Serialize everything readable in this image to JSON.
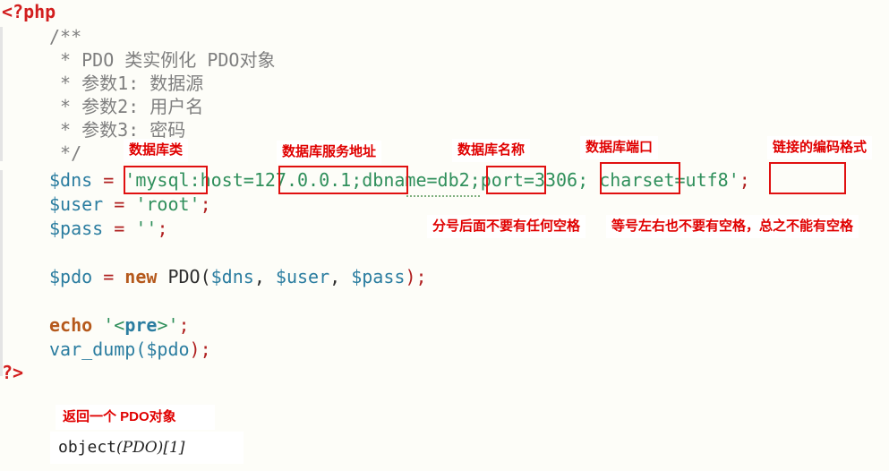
{
  "code": {
    "open_tag": "<?php",
    "comment_lines": [
      "/**",
      " * PDO 类实例化 PDO对象",
      " * 参数1: 数据源",
      " * 参数2: 用户名",
      " * 参数3: 密码",
      " */"
    ],
    "dns_line": {
      "var": "$dns",
      "eq": " = ",
      "q1": "'",
      "mysql": "mysql",
      "colon_host": ":host",
      "eq_host": "=",
      "host_value": "127.0.0.1;",
      "dbname_key": "dbname",
      "eq_db": "=",
      "db_value": "db2;",
      "port_key": "port",
      "eq_port": "=",
      "port_value": "3306;",
      "sp": " ",
      "charset_key": "charset",
      "eq_charset": "=",
      "charset_value": "utf8",
      "q2": "'",
      "semi": ";"
    },
    "user_line": {
      "var": "$user",
      "eq": " = ",
      "value": "'root'",
      "semi": ";"
    },
    "pass_line": {
      "var": "$pass",
      "eq": " = ",
      "value": "''",
      "semi": ";"
    },
    "pdo_line": {
      "var": "$pdo",
      "eq": " = ",
      "new": "new",
      "cls": " PDO(",
      "a1": "$dns",
      "c1": ", ",
      "a2": "$user",
      "c2": ", ",
      "a3": "$pass",
      "end": ");"
    },
    "echo_line": {
      "kw": "echo",
      "sp": " ",
      "value_a": "'<",
      "value_b": "pre",
      "value_c": ">'",
      "semi": ";"
    },
    "dump_line": {
      "fn": "var_dump(",
      "var": "$pdo",
      "end": ");"
    },
    "close_tag": "?>"
  },
  "annotations": {
    "db_type": "数据库类",
    "server_address": "数据库服务地址",
    "db_name": "数据库名称",
    "db_port": "数据库端口",
    "charset": "链接的编码格式",
    "no_space_after_semicolon": "分号后面不要有任何空格",
    "no_space_around_equals": "等号左右也不要有空格，总之不能有空格"
  },
  "result": {
    "title": "返回一个 PDO对象",
    "output_prefix": "object",
    "output_class": "(PDO)",
    "output_id": "[1]"
  },
  "colors": {
    "annotation_red": "#e00000",
    "box_red": "#e01010",
    "variable": "#2b7da0",
    "string": "#2f8f5b",
    "keyword": "#b5591c",
    "php_tag": "#d21e1e",
    "background": "#fdfdf8"
  }
}
